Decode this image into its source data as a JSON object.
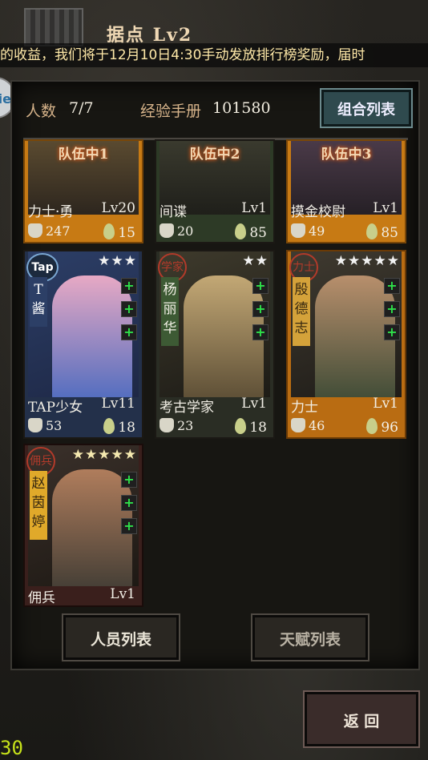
{
  "header": {
    "title": "据点  Lv2"
  },
  "ticker": {
    "text": "的收益，我们将于12月10日4:30手动发放排行榜奖励，届时"
  },
  "side_tab": {
    "label": "ie"
  },
  "stats": {
    "members_label": "人数",
    "members_value": "7/7",
    "exp_label": "经验手册",
    "exp_value": "101580"
  },
  "buttons": {
    "combo": "组合列表",
    "staff": "人员列表",
    "talent": "天赋列表",
    "back": "返 回"
  },
  "fps": "30",
  "team_cards": [
    {
      "team": "队伍中1",
      "name": "力士·勇",
      "level": "Lv20",
      "power": "247",
      "drops": "15"
    },
    {
      "team": "队伍中2",
      "name": "间谍",
      "level": "Lv1",
      "power": "20",
      "drops": "85"
    },
    {
      "team": "队伍中3",
      "name": "摸金校尉",
      "level": "Lv1",
      "power": "49",
      "drops": "85"
    }
  ],
  "cards": [
    {
      "badge": "Tap",
      "stars": "★★★",
      "vertical": "T 酱",
      "name": "TAP少女",
      "level": "Lv11",
      "power": "53",
      "drops": "18"
    },
    {
      "badge": "学家",
      "stars": "★★",
      "vertical": "杨丽华",
      "name": "考古学家",
      "level": "Lv1",
      "power": "23",
      "drops": "18"
    },
    {
      "badge": "力士",
      "stars": "★★★★★",
      "vertical": "殷德志",
      "name": "力士",
      "level": "Lv1",
      "power": "46",
      "drops": "96"
    },
    {
      "badge": "佣兵",
      "stars": "★★★★★",
      "vertical": "赵茵婷",
      "name": "佣兵",
      "level": "Lv1"
    }
  ],
  "colors": {
    "accent": "#c77a14",
    "plus": "#2ee04a",
    "fps": "#c7e21a"
  }
}
